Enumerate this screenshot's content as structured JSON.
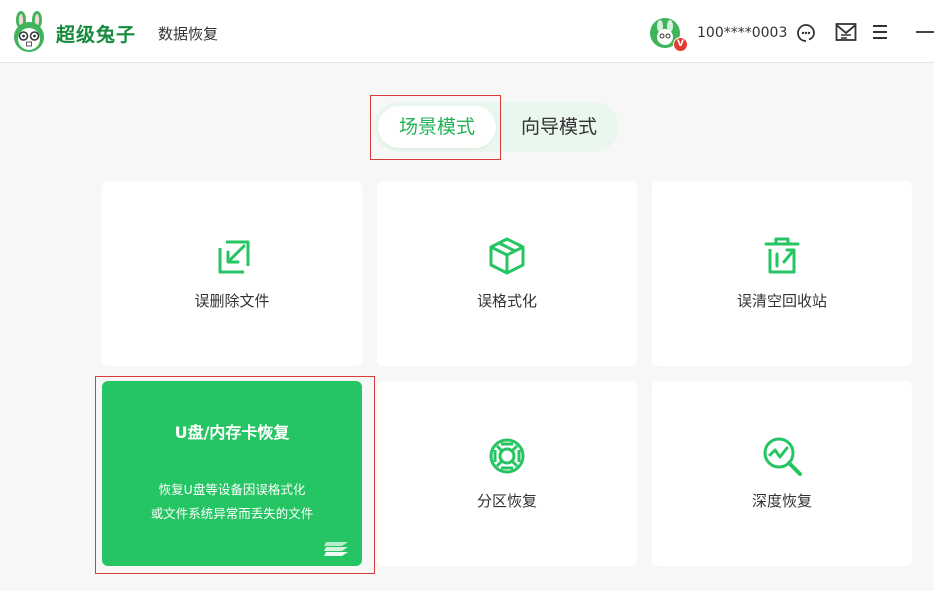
{
  "app": {
    "brand": "超级兔子",
    "product": "数据恢复"
  },
  "header": {
    "user_id": "100****0003",
    "vip_badge": "V",
    "icons": [
      "support-icon",
      "message-icon",
      "menu-icon",
      "minimize-icon"
    ]
  },
  "modes": {
    "active": "场景模式",
    "inactive": "向导模式"
  },
  "cards": {
    "deleted_files": "误删除文件",
    "formatted": "误格式化",
    "recycle_bin": "误清空回收站",
    "usb": {
      "title": "U盘/内存卡恢复",
      "desc_line1": "恢复U盘等设备因误格式化",
      "desc_line2": "或文件系统异常而丢失的文件"
    },
    "partition": "分区恢复",
    "deep_scan": "深度恢复"
  },
  "colors": {
    "accent": "#24c562",
    "brand_text": "#168a3c",
    "highlight": "#d93a3a",
    "background": "#f7f7f7"
  }
}
